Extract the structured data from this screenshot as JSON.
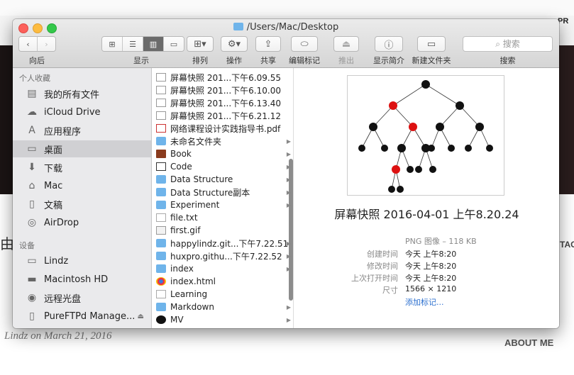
{
  "background": {
    "pr_text": "PR",
    "tac_text": "TAC",
    "big_char": "由",
    "author": "Lindz on March 21, 2016",
    "about": "ABOUT ME"
  },
  "window": {
    "title": "/Users/Mac/Desktop"
  },
  "toolbar": {
    "back_label": "向后",
    "display_label": "显示",
    "arrange_label": "排列",
    "action_label": "操作",
    "share_label": "共享",
    "tags_label": "编辑标记",
    "eject_label": "推出",
    "info_label": "显示简介",
    "new_folder_label": "新建文件夹",
    "search_label": "搜索",
    "search_placeholder": "搜索"
  },
  "sidebar": {
    "favorites_header": "个人收藏",
    "favorites": [
      {
        "label": "我的所有文件",
        "icon": "all-files-icon"
      },
      {
        "label": "iCloud Drive",
        "icon": "cloud-icon"
      },
      {
        "label": "应用程序",
        "icon": "applications-icon"
      },
      {
        "label": "桌面",
        "icon": "desktop-icon",
        "selected": true
      },
      {
        "label": "下载",
        "icon": "download-icon"
      },
      {
        "label": "Mac",
        "icon": "home-icon"
      },
      {
        "label": "文稿",
        "icon": "documents-icon"
      },
      {
        "label": "AirDrop",
        "icon": "airdrop-icon"
      }
    ],
    "devices_header": "设备",
    "devices": [
      {
        "label": "Lindz",
        "icon": "laptop-icon"
      },
      {
        "label": "Macintosh HD",
        "icon": "disk-icon"
      },
      {
        "label": "远程光盘",
        "icon": "optical-disc-icon"
      },
      {
        "label": "PureFTPd Manage...",
        "icon": "disk-image-icon"
      }
    ]
  },
  "files": [
    {
      "name": "屏幕快照 201...下午6.09.55",
      "kind": "img"
    },
    {
      "name": "屏幕快照 201...下午6.10.00",
      "kind": "img"
    },
    {
      "name": "屏幕快照 201...下午6.13.40",
      "kind": "img"
    },
    {
      "name": "屏幕快照 201...下午6.21.12",
      "kind": "img"
    },
    {
      "name": "网络课程设计实践指导书.pdf",
      "kind": "pdf"
    },
    {
      "name": "未命名文件夹",
      "kind": "folder",
      "has_children": true
    },
    {
      "name": "Book",
      "kind": "book",
      "has_children": true
    },
    {
      "name": "Code",
      "kind": "code",
      "has_children": true
    },
    {
      "name": "Data  Structure",
      "kind": "folder",
      "has_children": true
    },
    {
      "name": "Data  Structure副本",
      "kind": "folder",
      "has_children": true
    },
    {
      "name": "Experiment",
      "kind": "folder",
      "has_children": true
    },
    {
      "name": "file.txt",
      "kind": "doc"
    },
    {
      "name": "first.gif",
      "kind": "gif"
    },
    {
      "name": "happylindz.git...下午7.22.51",
      "kind": "folder",
      "has_children": true
    },
    {
      "name": "huxpro.githu...下午7.22.52",
      "kind": "folder",
      "has_children": true
    },
    {
      "name": "index",
      "kind": "folder",
      "has_children": true
    },
    {
      "name": "index.html",
      "kind": "html"
    },
    {
      "name": "Learning",
      "kind": "doc"
    },
    {
      "name": "Markdown",
      "kind": "folder",
      "has_children": true
    },
    {
      "name": "MV",
      "kind": "mv",
      "has_children": true
    }
  ],
  "preview": {
    "title": "屏幕快照 2016-04-01 上午8.20.24",
    "kind": "PNG 图像 – 118 KB",
    "created_label": "创建时间",
    "created_value": "今天 上午8:20",
    "modified_label": "修改时间",
    "modified_value": "今天 上午8:20",
    "opened_label": "上次打开时间",
    "opened_value": "今天 上午8:20",
    "size_label": "尺寸",
    "size_value": "1566 × 1210",
    "add_tags": "添加标记..."
  }
}
